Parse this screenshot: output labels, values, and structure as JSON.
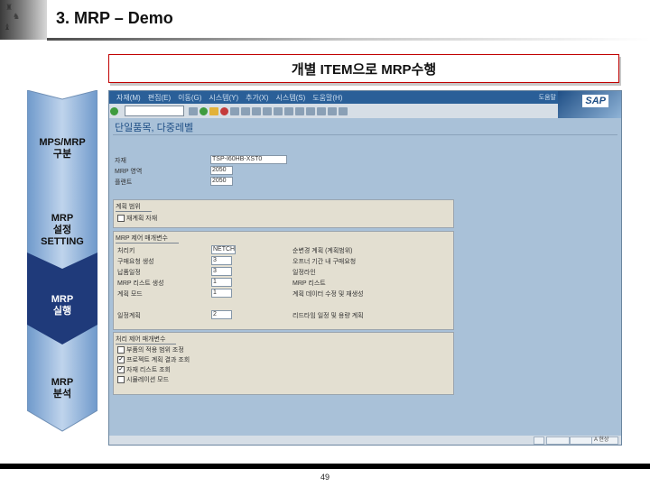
{
  "header": {
    "title": "3. MRP – Demo"
  },
  "banner": {
    "text": "개별 ITEM으로 MRP수행"
  },
  "flow": {
    "steps": [
      {
        "label": "MPS/MRP\n구분",
        "active": false
      },
      {
        "label": "MRP\n설정\nSETTING",
        "active": false
      },
      {
        "label": "MRP\n실행",
        "active": true
      },
      {
        "label": "MRP\n분석",
        "active": false
      }
    ]
  },
  "sap": {
    "menu": [
      "자재(M)",
      "편집(E)",
      "이동(G)",
      "시스템(Y)",
      "추가(X)",
      "시스템(S)",
      "도움말(H)"
    ],
    "system_text": "도움말",
    "logo": "SAP",
    "screen_title": "단일품목, 다중레벨",
    "header_fields": [
      {
        "label": "자재",
        "value": "TSP-I60HB-XST0"
      },
      {
        "label": "MRP 영역",
        "value": "2050"
      },
      {
        "label": "플랜트",
        "value": "2050"
      }
    ],
    "scope": {
      "title": "계획 범위",
      "items": [
        {
          "label": "재계획 자재",
          "checked": false
        }
      ]
    },
    "control": {
      "title": "MRP 제어 매개변수",
      "rows": [
        {
          "label": "처리키",
          "value": "NETCH",
          "desc": "순변경 계획 (계획범위)"
        },
        {
          "label": "구매요청 생성",
          "value": "3",
          "desc": "오프너 기간 내 구매요청"
        },
        {
          "label": "납품일정",
          "value": "3",
          "desc": "일정라인"
        },
        {
          "label": "MRP 리스트 생성",
          "value": "1",
          "desc": "MRP 리스트"
        },
        {
          "label": "계획 모드",
          "value": "1",
          "desc": "계획 데이터 수정 및 재생성"
        }
      ],
      "schedule": {
        "label": "일정계획",
        "value": "2",
        "desc": "리드타임 일정 및 용량 계획"
      }
    },
    "process": {
      "title": "처리 제어 매개변수",
      "items": [
        {
          "label": "부품의 적용 범위 조정",
          "checked": false
        },
        {
          "label": "프로젝트 계획 결과 조회",
          "checked": true
        },
        {
          "label": "자재 리스트 조회",
          "checked": true
        },
        {
          "label": "시뮬레이션 모드",
          "checked": false
        }
      ]
    },
    "status_text": "A 현상"
  },
  "footer": {
    "page": "49"
  }
}
